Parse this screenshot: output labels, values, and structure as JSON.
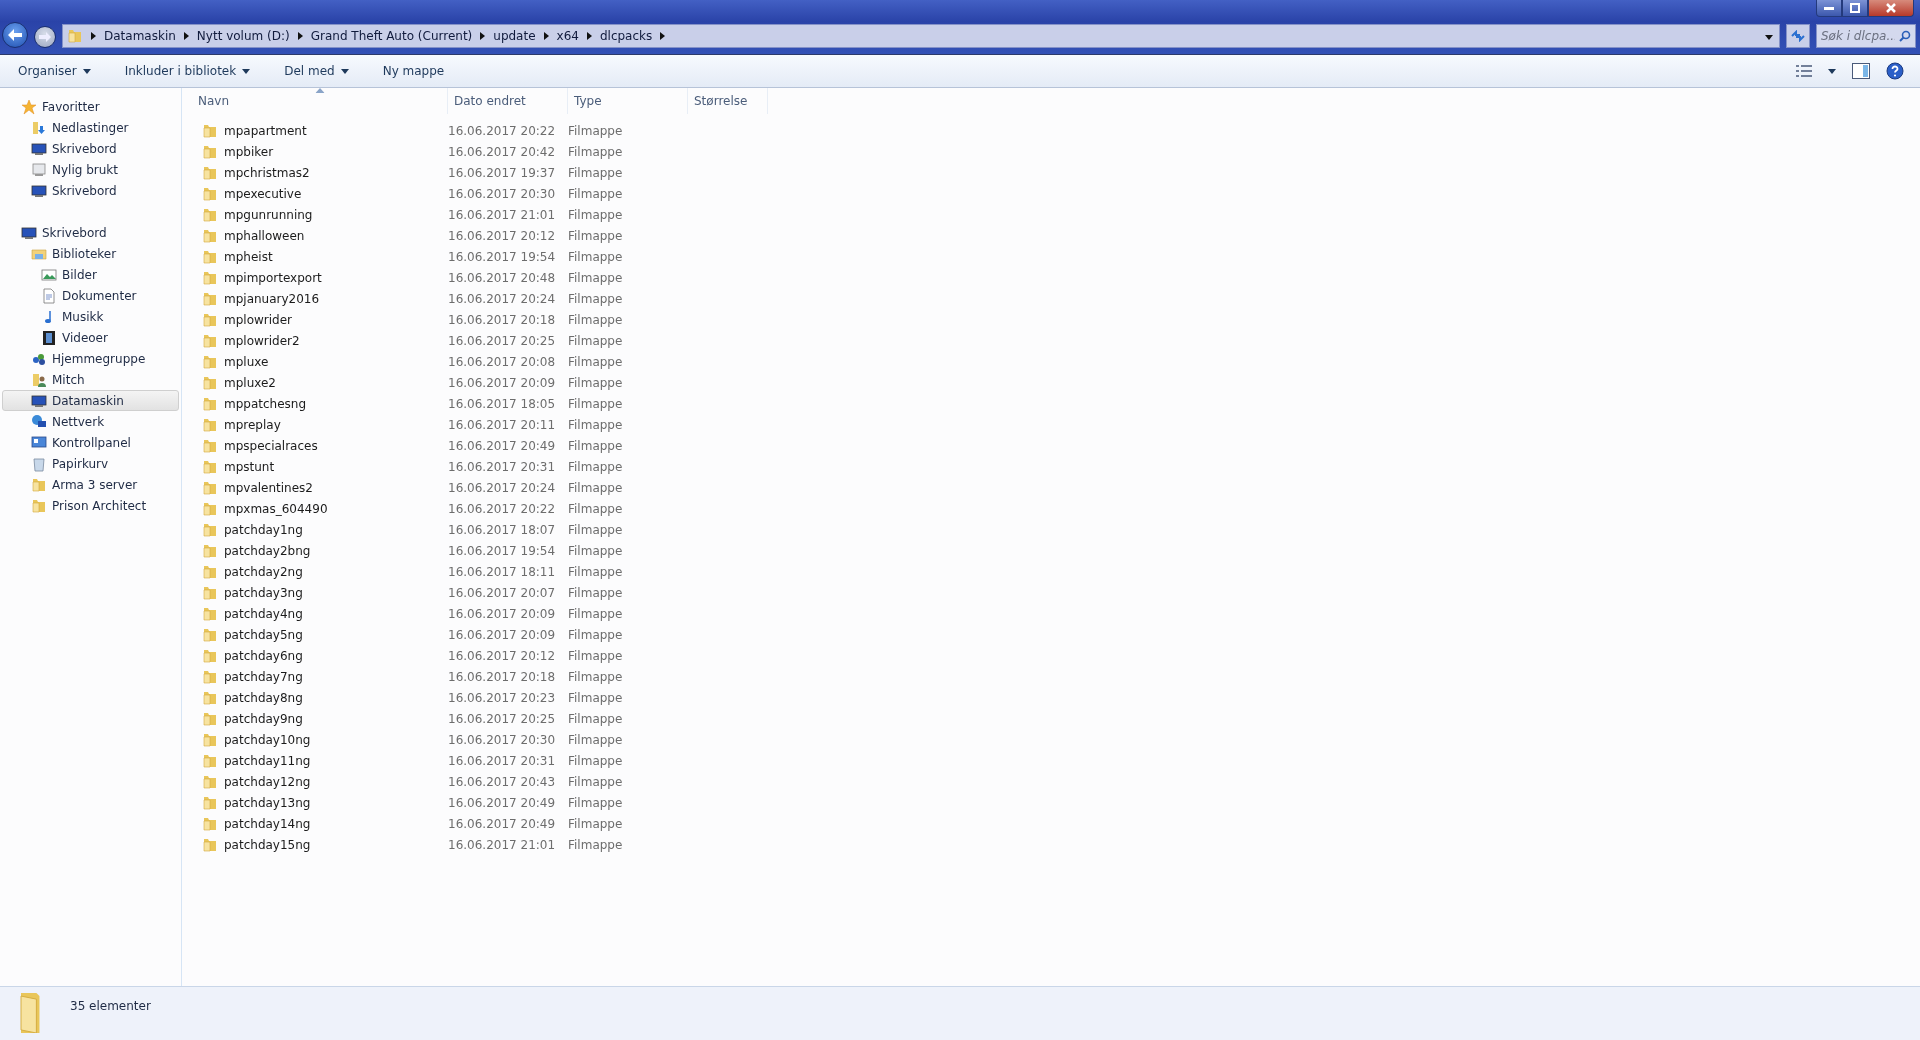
{
  "address": {
    "crumbs": [
      "Datamaskin",
      "Nytt volum (D:)",
      "Grand Theft Auto (Current)",
      "update",
      "x64",
      "dlcpacks"
    ]
  },
  "search": {
    "placeholder": "Søk i dlcpa..."
  },
  "toolbar": [
    {
      "label": "Organiser",
      "dropdown": true
    },
    {
      "label": "Inkluder i bibliotek",
      "dropdown": true
    },
    {
      "label": "Del med",
      "dropdown": true
    },
    {
      "label": "Ny mappe",
      "dropdown": false
    }
  ],
  "sidebar": [
    {
      "label": "Favoritter",
      "kind": "star",
      "selected": false,
      "children": [
        {
          "label": "Nedlastinger",
          "kind": "download",
          "selected": false
        },
        {
          "label": "Skrivebord",
          "kind": "desktop",
          "selected": false
        },
        {
          "label": "Nylig brukt",
          "kind": "recent",
          "selected": false
        },
        {
          "label": "Skrivebord",
          "kind": "desktop",
          "selected": false
        }
      ]
    },
    {
      "label": "Skrivebord",
      "kind": "desktop",
      "selected": false,
      "children": [
        {
          "label": "Biblioteker",
          "kind": "library",
          "selected": false,
          "children": [
            {
              "label": "Bilder",
              "kind": "pictures",
              "selected": false
            },
            {
              "label": "Dokumenter",
              "kind": "document",
              "selected": false
            },
            {
              "label": "Musikk",
              "kind": "music",
              "selected": false
            },
            {
              "label": "Videoer",
              "kind": "video",
              "selected": false
            }
          ]
        },
        {
          "label": "Hjemmegruppe",
          "kind": "homegroup",
          "selected": false
        },
        {
          "label": "Mitch",
          "kind": "user",
          "selected": false
        },
        {
          "label": "Datamaskin",
          "kind": "computer",
          "selected": true
        },
        {
          "label": "Nettverk",
          "kind": "network",
          "selected": false
        },
        {
          "label": "Kontrollpanel",
          "kind": "control",
          "selected": false
        },
        {
          "label": "Papirkurv",
          "kind": "bin",
          "selected": false
        },
        {
          "label": "Arma 3 server",
          "kind": "folder",
          "selected": false
        },
        {
          "label": "Prison Architect",
          "kind": "folder",
          "selected": false
        }
      ]
    }
  ],
  "table": {
    "columns": [
      {
        "label": "Navn",
        "sorted": true
      },
      {
        "label": "Dato endret",
        "sorted": false
      },
      {
        "label": "Type",
        "sorted": false
      },
      {
        "label": "Størrelse",
        "sorted": false
      }
    ],
    "rows": [
      {
        "name": "mpapartment",
        "date": "16.06.2017 20:22",
        "type": "Filmappe"
      },
      {
        "name": "mpbiker",
        "date": "16.06.2017 20:42",
        "type": "Filmappe"
      },
      {
        "name": "mpchristmas2",
        "date": "16.06.2017 19:37",
        "type": "Filmappe"
      },
      {
        "name": "mpexecutive",
        "date": "16.06.2017 20:30",
        "type": "Filmappe"
      },
      {
        "name": "mpgunrunning",
        "date": "16.06.2017 21:01",
        "type": "Filmappe"
      },
      {
        "name": "mphalloween",
        "date": "16.06.2017 20:12",
        "type": "Filmappe"
      },
      {
        "name": "mpheist",
        "date": "16.06.2017 19:54",
        "type": "Filmappe"
      },
      {
        "name": "mpimportexport",
        "date": "16.06.2017 20:48",
        "type": "Filmappe"
      },
      {
        "name": "mpjanuary2016",
        "date": "16.06.2017 20:24",
        "type": "Filmappe"
      },
      {
        "name": "mplowrider",
        "date": "16.06.2017 20:18",
        "type": "Filmappe"
      },
      {
        "name": "mplowrider2",
        "date": "16.06.2017 20:25",
        "type": "Filmappe"
      },
      {
        "name": "mpluxe",
        "date": "16.06.2017 20:08",
        "type": "Filmappe"
      },
      {
        "name": "mpluxe2",
        "date": "16.06.2017 20:09",
        "type": "Filmappe"
      },
      {
        "name": "mppatchesng",
        "date": "16.06.2017 18:05",
        "type": "Filmappe"
      },
      {
        "name": "mpreplay",
        "date": "16.06.2017 20:11",
        "type": "Filmappe"
      },
      {
        "name": "mpspecialraces",
        "date": "16.06.2017 20:49",
        "type": "Filmappe"
      },
      {
        "name": "mpstunt",
        "date": "16.06.2017 20:31",
        "type": "Filmappe"
      },
      {
        "name": "mpvalentines2",
        "date": "16.06.2017 20:24",
        "type": "Filmappe"
      },
      {
        "name": "mpxmas_604490",
        "date": "16.06.2017 20:22",
        "type": "Filmappe"
      },
      {
        "name": "patchday1ng",
        "date": "16.06.2017 18:07",
        "type": "Filmappe"
      },
      {
        "name": "patchday2bng",
        "date": "16.06.2017 19:54",
        "type": "Filmappe"
      },
      {
        "name": "patchday2ng",
        "date": "16.06.2017 18:11",
        "type": "Filmappe"
      },
      {
        "name": "patchday3ng",
        "date": "16.06.2017 20:07",
        "type": "Filmappe"
      },
      {
        "name": "patchday4ng",
        "date": "16.06.2017 20:09",
        "type": "Filmappe"
      },
      {
        "name": "patchday5ng",
        "date": "16.06.2017 20:09",
        "type": "Filmappe"
      },
      {
        "name": "patchday6ng",
        "date": "16.06.2017 20:12",
        "type": "Filmappe"
      },
      {
        "name": "patchday7ng",
        "date": "16.06.2017 20:18",
        "type": "Filmappe"
      },
      {
        "name": "patchday8ng",
        "date": "16.06.2017 20:23",
        "type": "Filmappe"
      },
      {
        "name": "patchday9ng",
        "date": "16.06.2017 20:25",
        "type": "Filmappe"
      },
      {
        "name": "patchday10ng",
        "date": "16.06.2017 20:30",
        "type": "Filmappe"
      },
      {
        "name": "patchday11ng",
        "date": "16.06.2017 20:31",
        "type": "Filmappe"
      },
      {
        "name": "patchday12ng",
        "date": "16.06.2017 20:43",
        "type": "Filmappe"
      },
      {
        "name": "patchday13ng",
        "date": "16.06.2017 20:49",
        "type": "Filmappe"
      },
      {
        "name": "patchday14ng",
        "date": "16.06.2017 20:49",
        "type": "Filmappe"
      },
      {
        "name": "patchday15ng",
        "date": "16.06.2017 21:01",
        "type": "Filmappe"
      }
    ]
  },
  "status_bar": {
    "text": "35 elementer"
  }
}
